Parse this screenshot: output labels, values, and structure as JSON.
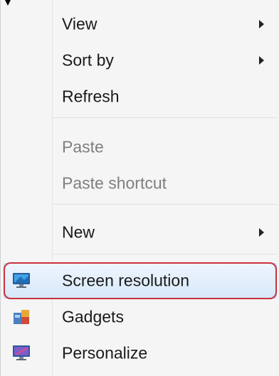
{
  "context_menu": {
    "items": [
      {
        "label": "View",
        "has_submenu": true,
        "enabled": true
      },
      {
        "label": "Sort by",
        "has_submenu": true,
        "enabled": true
      },
      {
        "label": "Refresh",
        "has_submenu": false,
        "enabled": true
      },
      {
        "label": "Paste",
        "has_submenu": false,
        "enabled": false
      },
      {
        "label": "Paste shortcut",
        "has_submenu": false,
        "enabled": false
      },
      {
        "label": "New",
        "has_submenu": true,
        "enabled": true
      },
      {
        "label": "Screen resolution",
        "has_submenu": false,
        "enabled": true,
        "icon": "monitor-icon",
        "highlighted": true
      },
      {
        "label": "Gadgets",
        "has_submenu": false,
        "enabled": true,
        "icon": "gadgets-icon"
      },
      {
        "label": "Personalize",
        "has_submenu": false,
        "enabled": true,
        "icon": "personalize-icon"
      }
    ],
    "colors": {
      "highlight_border": "#c8323c",
      "hover_fill": "#d7e8fa",
      "disabled_text": "#7f7f7f"
    }
  }
}
